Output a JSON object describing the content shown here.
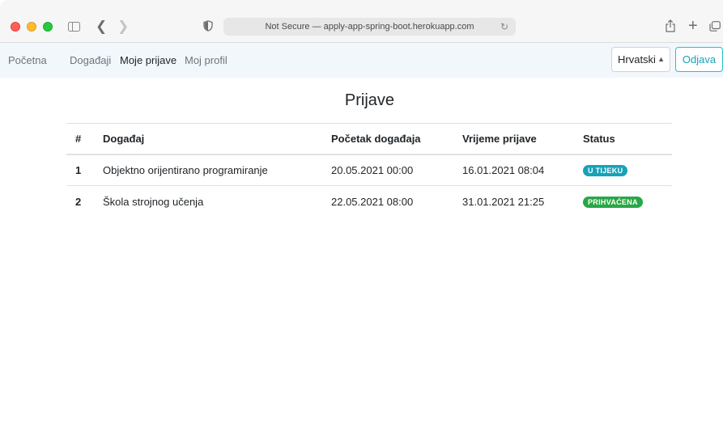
{
  "browser": {
    "address": "Not Secure — apply-app-spring-boot.herokuapp.com"
  },
  "navbar": {
    "links": [
      {
        "label": "Početna",
        "active": false
      },
      {
        "label": "Događaji",
        "active": false
      },
      {
        "label": "Moje prijave",
        "active": true
      },
      {
        "label": "Moj profil",
        "active": false
      }
    ],
    "language": "Hrvatski",
    "logout_label": "Odjava"
  },
  "page": {
    "title": "Prijave"
  },
  "table": {
    "headers": {
      "num": "#",
      "event": "Događaj",
      "start": "Početak događaja",
      "registered": "Vrijeme prijave",
      "status": "Status"
    },
    "rows": [
      {
        "num": "1",
        "event": "Objektno orijentirano programiranje",
        "start": "20.05.2021 00:00",
        "registered": "16.01.2021 08:04",
        "status": "U TIJEKU",
        "status_color": "#17a2b8"
      },
      {
        "num": "2",
        "event": "Škola strojnog učenja",
        "start": "22.05.2021 08:00",
        "registered": "31.01.2021 21:25",
        "status": "PRIHVAĆENA",
        "status_color": "#28a745"
      }
    ]
  }
}
